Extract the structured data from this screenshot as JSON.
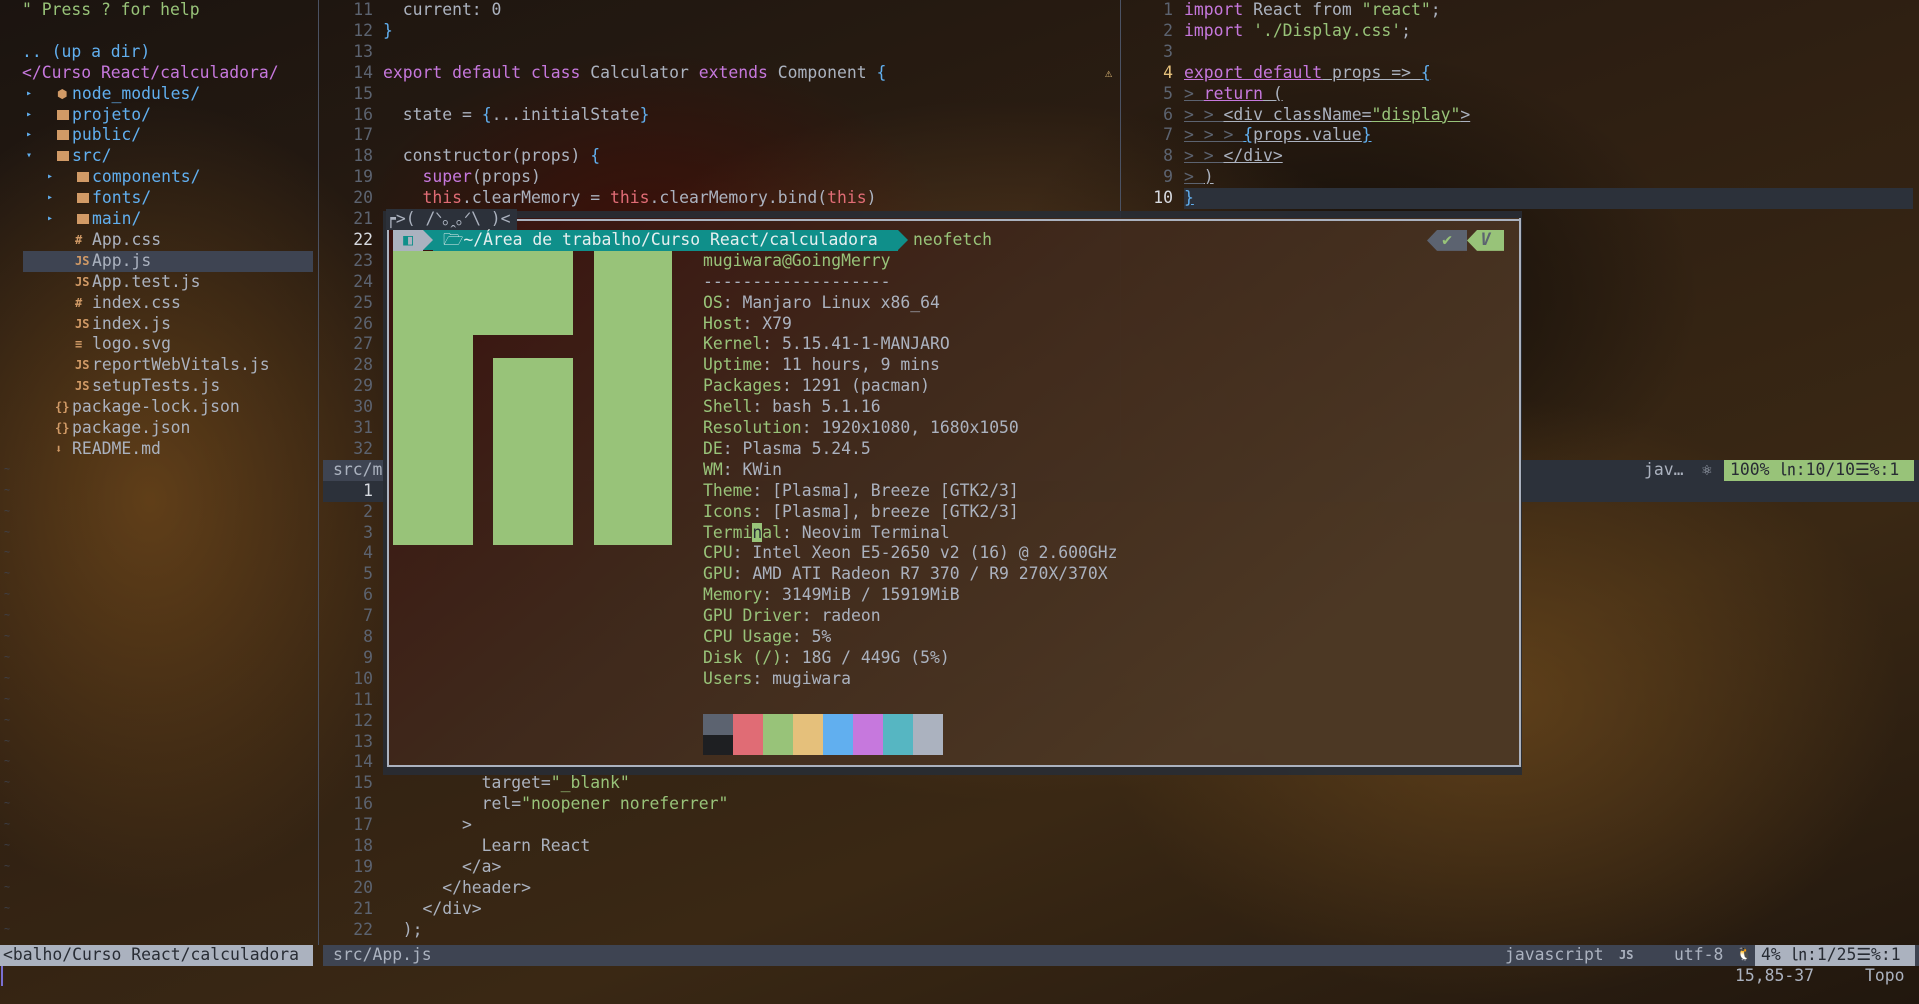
{
  "nerdtree": {
    "help": "\" Press ? for help",
    "up_dir": ".. (up a dir)",
    "root": "</Curso React/calculadora/",
    "items": [
      {
        "arrow": "▸",
        "icon": "node",
        "name": "node_modules/",
        "level": 0
      },
      {
        "arrow": "▸",
        "icon": "folder",
        "name": "projeto/",
        "level": 0
      },
      {
        "arrow": "▸",
        "icon": "folder",
        "name": "public/",
        "level": 0
      },
      {
        "arrow": "▾",
        "icon": "folder",
        "name": "src/",
        "level": 0
      },
      {
        "arrow": "▸",
        "icon": "folder",
        "name": "components/",
        "level": 1
      },
      {
        "arrow": "▸",
        "icon": "folder",
        "name": "fonts/",
        "level": 1
      },
      {
        "arrow": "▸",
        "icon": "folder",
        "name": "main/",
        "level": 1
      },
      {
        "arrow": "",
        "icon": "#",
        "name": "App.css",
        "level": 1
      },
      {
        "arrow": "",
        "icon": "JS",
        "name": "App.js",
        "level": 1,
        "selected": true
      },
      {
        "arrow": "",
        "icon": "JS",
        "name": "App.test.js",
        "level": 1
      },
      {
        "arrow": "",
        "icon": "#",
        "name": "index.css",
        "level": 1
      },
      {
        "arrow": "",
        "icon": "JS",
        "name": "index.js",
        "level": 1
      },
      {
        "arrow": "",
        "icon": "≡",
        "name": "logo.svg",
        "level": 1
      },
      {
        "arrow": "",
        "icon": "JS",
        "name": "reportWebVitals.js",
        "level": 1
      },
      {
        "arrow": "",
        "icon": "JS",
        "name": "setupTests.js",
        "level": 1
      },
      {
        "arrow": "",
        "icon": "{}",
        "name": "package-lock.json",
        "level": 0
      },
      {
        "arrow": "",
        "icon": "{}",
        "name": "package.json",
        "level": 0
      },
      {
        "arrow": "",
        "icon": "⬇",
        "name": "README.md",
        "level": 0
      }
    ],
    "status": "<balho/Curso React/calculadora"
  },
  "editor_top": {
    "lines": [
      {
        "n": 11,
        "tokens": [
          [
            "  current: 0",
            "t"
          ]
        ]
      },
      {
        "n": 12,
        "tokens": [
          [
            "}",
            "b"
          ]
        ]
      },
      {
        "n": 13,
        "tokens": []
      },
      {
        "n": 14,
        "tokens": [
          [
            "export default class ",
            "k"
          ],
          [
            "Calculator ",
            "t"
          ],
          [
            "extends ",
            "k"
          ],
          [
            "Component ",
            "t"
          ],
          [
            "{",
            "b"
          ]
        ]
      },
      {
        "n": 15,
        "tokens": []
      },
      {
        "n": 16,
        "tokens": [
          [
            "  state = ",
            "t"
          ],
          [
            "{",
            "b"
          ],
          [
            "...initialState",
            "t"
          ],
          [
            "}",
            "b"
          ]
        ]
      },
      {
        "n": 17,
        "tokens": []
      },
      {
        "n": 18,
        "tokens": [
          [
            "  constructor(props) ",
            "t"
          ],
          [
            "{",
            "b"
          ]
        ]
      },
      {
        "n": 19,
        "tokens": [
          [
            "    ",
            "t"
          ],
          [
            "super",
            "k"
          ],
          [
            "(props)",
            "t"
          ]
        ]
      },
      {
        "n": 20,
        "tokens": [
          [
            "    ",
            "t"
          ],
          [
            "this",
            "r"
          ],
          [
            ".clearMemory = ",
            "t"
          ],
          [
            "this",
            "r"
          ],
          [
            ".clearMemory.bind(",
            "t"
          ],
          [
            "this",
            "r"
          ],
          [
            ")",
            "t"
          ]
        ]
      },
      {
        "n": 21,
        "tokens": []
      },
      {
        "n": 22,
        "tokens": [],
        "current": true
      },
      {
        "n": 23,
        "tokens": []
      },
      {
        "n": 24,
        "tokens": []
      },
      {
        "n": 25,
        "tokens": []
      },
      {
        "n": 26,
        "tokens": []
      },
      {
        "n": 27,
        "tokens": []
      },
      {
        "n": 28,
        "tokens": []
      },
      {
        "n": 29,
        "tokens": []
      },
      {
        "n": 30,
        "tokens": []
      },
      {
        "n": 31,
        "tokens": []
      },
      {
        "n": 32,
        "tokens": []
      }
    ],
    "status": "src/m"
  },
  "right_pane": {
    "warning_icon": "⚠",
    "lines": [
      {
        "n": 1,
        "tokens": [
          [
            "import ",
            "k"
          ],
          [
            "React from ",
            "t"
          ],
          [
            "\"react\"",
            "s"
          ],
          [
            ";",
            "t"
          ]
        ]
      },
      {
        "n": 2,
        "tokens": [
          [
            "import ",
            "k"
          ],
          [
            "'./Display.css'",
            "s"
          ],
          [
            ";",
            "t"
          ]
        ]
      },
      {
        "n": 3,
        "tokens": []
      },
      {
        "n": 4,
        "warn": true,
        "tokens": [
          [
            "export default",
            "k u"
          ],
          [
            " props => ",
            "t u"
          ],
          [
            "{",
            "b u"
          ]
        ]
      },
      {
        "n": 5,
        "tokens": [
          [
            "> ",
            "g u"
          ],
          [
            "return",
            "k u"
          ],
          [
            " (",
            "t u"
          ]
        ]
      },
      {
        "n": 6,
        "tokens": [
          [
            "> > ",
            "g u"
          ],
          [
            "<div className=",
            "t u"
          ],
          [
            "\"display\"",
            "s u"
          ],
          [
            ">",
            "t u"
          ]
        ]
      },
      {
        "n": 7,
        "tokens": [
          [
            "> > > ",
            "g u"
          ],
          [
            "{",
            "b u"
          ],
          [
            "props.value",
            "t u"
          ],
          [
            "}",
            "b u"
          ]
        ]
      },
      {
        "n": 8,
        "tokens": [
          [
            "> > ",
            "g u"
          ],
          [
            "</div>",
            "t u"
          ]
        ]
      },
      {
        "n": 9,
        "tokens": [
          [
            "> ",
            "g u"
          ],
          [
            ")",
            "t u"
          ]
        ]
      },
      {
        "n": 10,
        "tokens": [
          [
            "}",
            "b u"
          ]
        ],
        "current": true
      }
    ],
    "status": {
      "filetype": "jav…",
      "icon": "⚛",
      "info": "100% ㏑:10/10☰%:1"
    }
  },
  "editor_bottom": {
    "lines": [
      {
        "n": 1,
        "tokens": [],
        "current": true
      },
      {
        "n": 2,
        "tokens": []
      },
      {
        "n": 3,
        "tokens": []
      },
      {
        "n": 4,
        "tokens": []
      },
      {
        "n": 5,
        "tokens": []
      },
      {
        "n": 6,
        "tokens": []
      },
      {
        "n": 7,
        "tokens": []
      },
      {
        "n": 8,
        "tokens": []
      },
      {
        "n": 9,
        "tokens": []
      },
      {
        "n": 10,
        "tokens": []
      },
      {
        "n": 11,
        "tokens": []
      },
      {
        "n": 12,
        "tokens": []
      },
      {
        "n": 13,
        "tokens": []
      },
      {
        "n": 14,
        "tokens": []
      },
      {
        "n": 15,
        "tokens": [
          [
            "          target=",
            "t"
          ],
          [
            "\"_blank\"",
            "s"
          ]
        ]
      },
      {
        "n": 16,
        "tokens": [
          [
            "          rel=",
            "t"
          ],
          [
            "\"noopener noreferrer\"",
            "s"
          ]
        ]
      },
      {
        "n": 17,
        "tokens": [
          [
            "        >",
            "t"
          ]
        ]
      },
      {
        "n": 18,
        "tokens": [
          [
            "          Learn React",
            "t"
          ]
        ]
      },
      {
        "n": 19,
        "tokens": [
          [
            "        </a>",
            "t"
          ]
        ]
      },
      {
        "n": 20,
        "tokens": [
          [
            "      </header>",
            "t"
          ]
        ]
      },
      {
        "n": 21,
        "tokens": [
          [
            "    </div>",
            "t"
          ]
        ]
      },
      {
        "n": 22,
        "tokens": [
          [
            "  );",
            "t"
          ]
        ]
      }
    ]
  },
  "terminal": {
    "title": "┍>( /ᐠ｡ꞈ｡ᐟ\\ )<",
    "prompt": {
      "os_icon": "◧",
      "folder_icon": "🗁",
      "path": "~/Área de trabalho/Curso React/calculadora",
      "command": "neofetch",
      "ok": "✔",
      "mode": "V"
    },
    "user_host": "mugiwara@GoingMerry",
    "separator": "-------------------",
    "fields": [
      {
        "label": "OS",
        "value": "Manjaro Linux x86_64"
      },
      {
        "label": "Host",
        "value": "X79"
      },
      {
        "label": "Kernel",
        "value": "5.15.41-1-MANJARO"
      },
      {
        "label": "Uptime",
        "value": "11 hours, 9 mins"
      },
      {
        "label": "Packages",
        "value": "1291 (pacman)"
      },
      {
        "label": "Shell",
        "value": "bash 5.1.16"
      },
      {
        "label": "Resolution",
        "value": "1920x1080, 1680x1050"
      },
      {
        "label": "DE",
        "value": "Plasma 5.24.5"
      },
      {
        "label": "WM",
        "value": "KWin"
      },
      {
        "label": "Theme",
        "value": "[Plasma], Breeze [GTK2/3]"
      },
      {
        "label": "Icons",
        "value": "[Plasma], breeze [GTK2/3]"
      },
      {
        "label": "Terminal",
        "value": "Neovim Terminal",
        "cursor": 5
      },
      {
        "label": "CPU",
        "value": "Intel Xeon E5-2650 v2 (16) @ 2.600GHz"
      },
      {
        "label": "GPU",
        "value": "AMD ATI Radeon R7 370 / R9 270X/370X"
      },
      {
        "label": "Memory",
        "value": "3149MiB / 15919MiB"
      },
      {
        "label": "GPU Driver",
        "value": "radeon"
      },
      {
        "label": "CPU Usage",
        "value": "5%"
      },
      {
        "label": "Disk (/)",
        "value": "18G / 449G (5%)"
      },
      {
        "label": "Users",
        "value": "mugiwara"
      }
    ],
    "palette": {
      "top": [
        "#5c6370",
        "#e06c75",
        "#98c379",
        "#e5c07b",
        "#61afef",
        "#c678dd",
        "#56b6c2",
        "#abb2bf"
      ],
      "bottom": [
        "#1e1f22",
        "#e06c75",
        "#98c379",
        "#e5c07b",
        "#61afef",
        "#c678dd",
        "#56b6c2",
        "#abb2bf"
      ]
    }
  },
  "statusline": {
    "file": "src/App.js",
    "filetype": "javascript",
    "filetype_icon": "JS",
    "encoding": "utf-8",
    "os_icon": "🐧",
    "info": "4% ㏑:1/25☰%:1"
  },
  "cmdline": {
    "position": "15,85-37",
    "scroll": "Topo"
  }
}
